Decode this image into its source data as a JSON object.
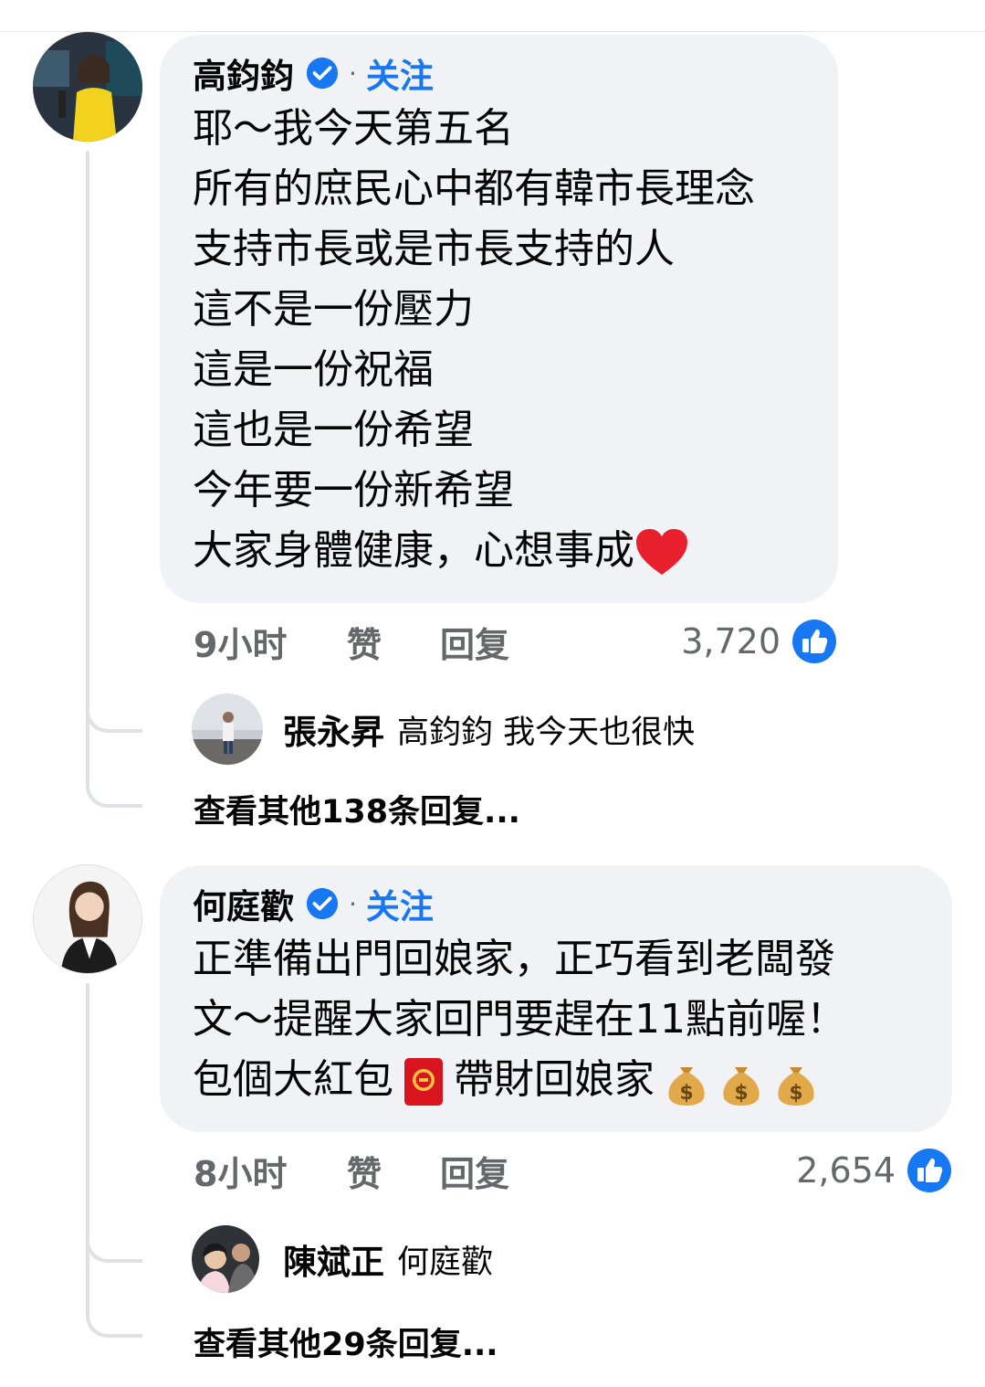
{
  "comments": [
    {
      "author": "高鈞鈞",
      "follow_label": "关注",
      "dot": "·",
      "lines": [
        "耶～我今天第五名",
        "所有的庶民心中都有韓市長理念",
        "支持市長或是市長支持的人",
        "這不是一份壓力",
        "這是一份祝福",
        "這也是一份希望",
        "今年要一份新希望",
        "大家身體健康，心想事成"
      ],
      "time": "9小时",
      "like_label": "赞",
      "reply_label": "回复",
      "reaction_count": "3,720",
      "reply": {
        "author": "張永昇",
        "text": "高鈞鈞 我今天也很快"
      },
      "more_replies": "查看其他138条回复..."
    },
    {
      "author": "何庭歡",
      "follow_label": "关注",
      "dot": "·",
      "lines": [
        "正準備出門回娘家，正巧看到老闆發",
        "文～提醒大家回門要趕在11點前喔！",
        "包個大紅包",
        "帶財回娘家"
      ],
      "time": "8小时",
      "like_label": "赞",
      "reply_label": "回复",
      "reaction_count": "2,654",
      "reply": {
        "author": "陳斌正",
        "text": "何庭歡"
      },
      "more_replies": "查看其他29条回复..."
    }
  ],
  "colors": {
    "link": "#1877f2",
    "bubble": "#f0f2f5",
    "secondary": "#65676b",
    "heart": "#e8202e"
  }
}
